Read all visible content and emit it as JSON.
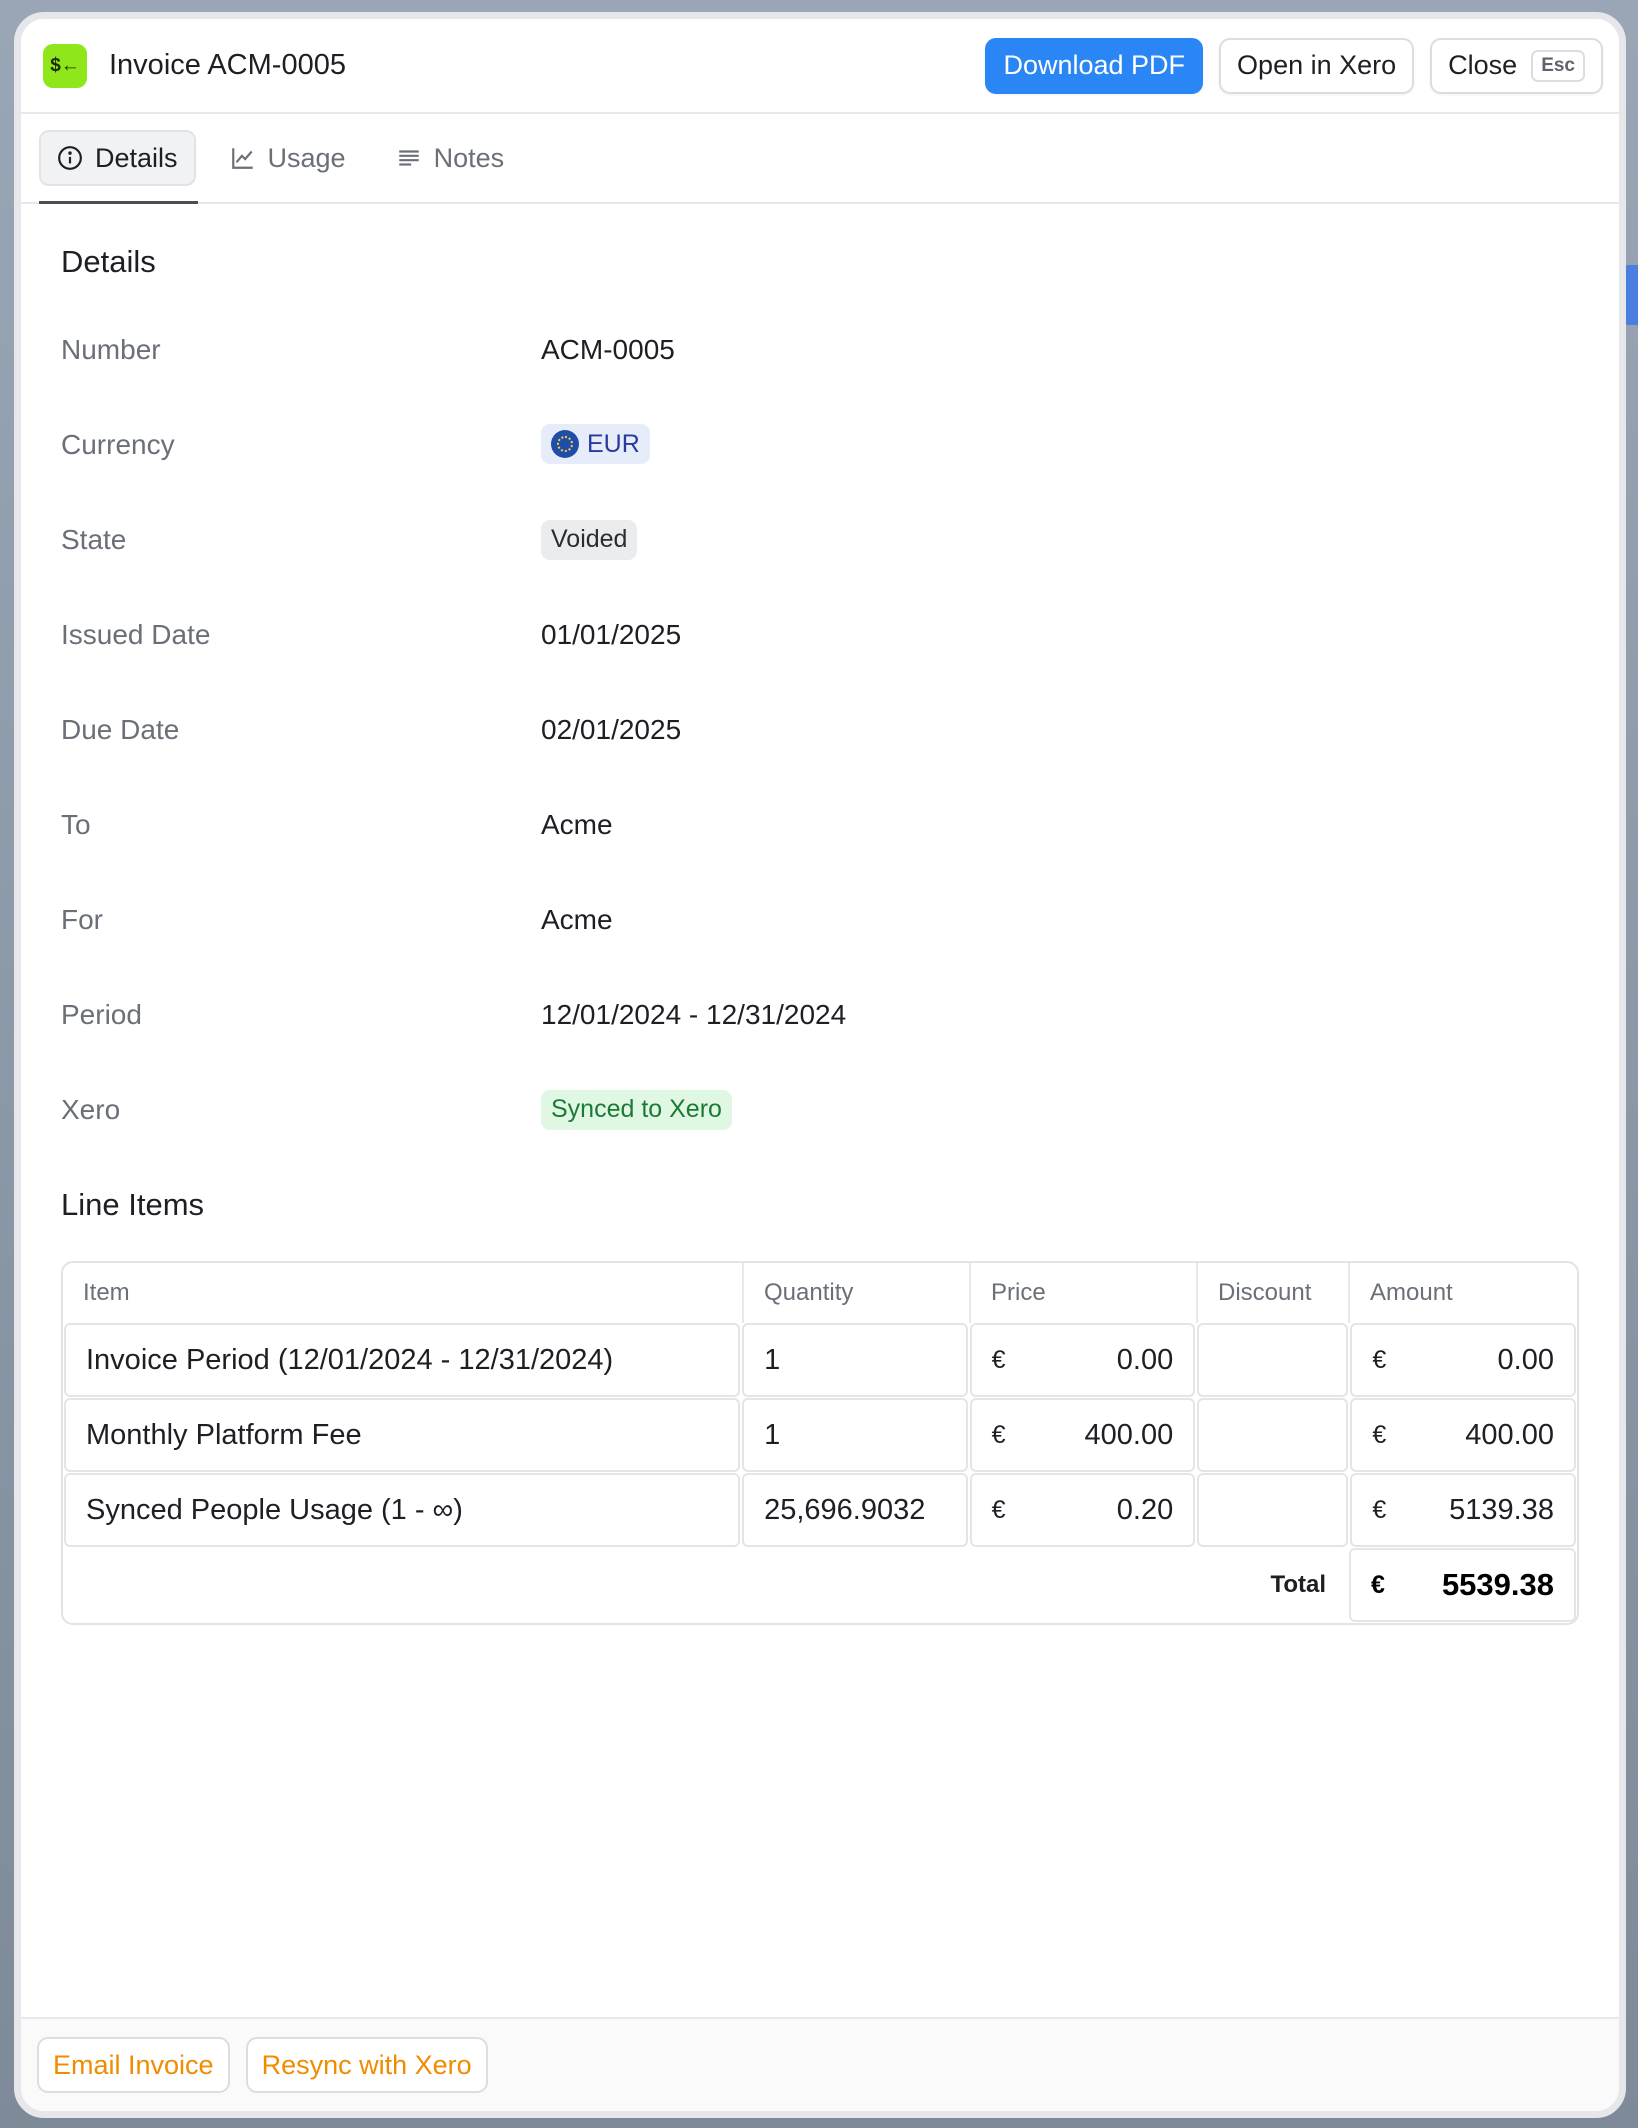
{
  "header": {
    "app_icon": "$←",
    "title": "Invoice ACM-0005",
    "download_label": "Download PDF",
    "open_label": "Open in Xero",
    "close_label": "Close",
    "close_shortcut": "Esc"
  },
  "tabs": [
    {
      "label": "Details",
      "icon": "info-icon",
      "active": true
    },
    {
      "label": "Usage",
      "icon": "chart-icon",
      "active": false
    },
    {
      "label": "Notes",
      "icon": "lines-icon",
      "active": false
    }
  ],
  "details": {
    "section_title": "Details",
    "fields": [
      {
        "label": "Number",
        "value": "ACM-0005"
      },
      {
        "label": "Currency",
        "value": "EUR"
      },
      {
        "label": "State",
        "value": "Voided"
      },
      {
        "label": "Issued Date",
        "value": "01/01/2025"
      },
      {
        "label": "Due Date",
        "value": "02/01/2025"
      },
      {
        "label": "To",
        "value": "Acme"
      },
      {
        "label": "For",
        "value": "Acme"
      },
      {
        "label": "Period",
        "value": "12/01/2024 - 12/31/2024"
      },
      {
        "label": "Xero",
        "value": "Synced to Xero"
      }
    ]
  },
  "line_items": {
    "section_title": "Line Items",
    "columns": [
      "Item",
      "Quantity",
      "Price",
      "Discount",
      "Amount"
    ],
    "currency_symbol": "€",
    "rows": [
      {
        "item": "Invoice Period (12/01/2024 - 12/31/2024)",
        "quantity": "1",
        "price": "0.00",
        "discount": "",
        "amount": "0.00"
      },
      {
        "item": "Monthly Platform Fee",
        "quantity": "1",
        "price": "400.00",
        "discount": "",
        "amount": "400.00"
      },
      {
        "item": "Synced People Usage (1 - ∞)",
        "quantity": "25,696.9032",
        "price": "0.20",
        "discount": "",
        "amount": "5139.38"
      }
    ],
    "total_label": "Total",
    "total_value": "5539.38"
  },
  "footer": {
    "email_label": "Email Invoice",
    "resync_label": "Resync with Xero"
  },
  "colors": {
    "primary": "#2b86f5",
    "app_icon": "#8ee61b",
    "footer_action": "#f08c00",
    "synced_badge": "#dff7e3",
    "currency_badge": "#e7ecfb"
  }
}
